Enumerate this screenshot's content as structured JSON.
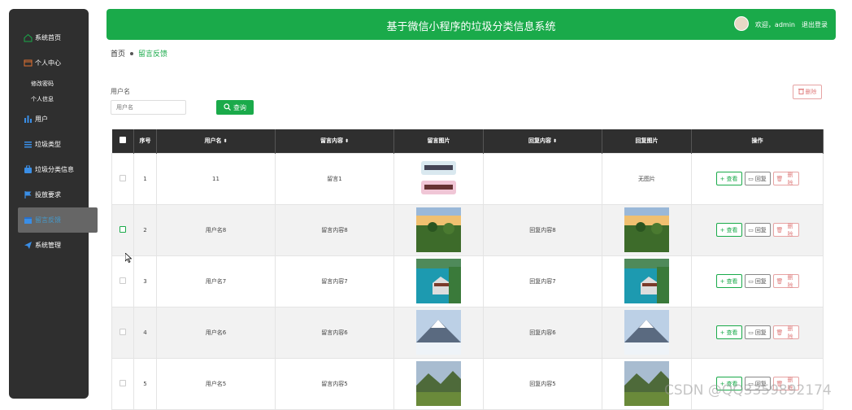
{
  "sidebar": {
    "items": [
      {
        "label": "系统首页",
        "icon": "home-icon"
      },
      {
        "label": "个人中心",
        "icon": "wallet-icon"
      },
      {
        "label": "用户",
        "icon": "bar-chart-icon"
      },
      {
        "label": "垃圾类型",
        "icon": "list-icon"
      },
      {
        "label": "垃圾分类信息",
        "icon": "briefcase-icon"
      },
      {
        "label": "投放要求",
        "icon": "flag-icon"
      },
      {
        "label": "留言反馈",
        "icon": "calendar-icon"
      },
      {
        "label": "系统管理",
        "icon": "send-icon"
      }
    ],
    "sub_items": [
      "修改密码",
      "个人信息"
    ]
  },
  "header": {
    "title": "基于微信小程序的垃圾分类信息系统",
    "welcome": "欢迎，admin",
    "logout": "退出登录"
  },
  "breadcrumb": {
    "home": "首页",
    "current": "留言反馈"
  },
  "search": {
    "label": "用户名",
    "placeholder": "用户名",
    "button": "查询"
  },
  "toolbar": {
    "delete_label": "删除"
  },
  "table": {
    "headers": [
      "序号",
      "用户名",
      "留言内容",
      "留言图片",
      "回复内容",
      "回复图片",
      "操作"
    ],
    "rows": [
      {
        "index": "1",
        "username": "11",
        "content": "留言1",
        "reply": "",
        "reply_image_text": "无图片"
      },
      {
        "index": "2",
        "username": "用户名8",
        "content": "留言内容8",
        "reply": "回复内容8",
        "reply_image_text": ""
      },
      {
        "index": "3",
        "username": "用户名7",
        "content": "留言内容7",
        "reply": "回复内容7",
        "reply_image_text": ""
      },
      {
        "index": "4",
        "username": "用户名6",
        "content": "留言内容6",
        "reply": "回复内容6",
        "reply_image_text": ""
      },
      {
        "index": "5",
        "username": "用户名5",
        "content": "留言内容5",
        "reply": "回复内容5",
        "reply_image_text": ""
      }
    ],
    "actions": {
      "view": "查看",
      "reply": "回复",
      "delete": "删除"
    }
  },
  "watermark": "CSDN @QQ3359892174",
  "colors": {
    "accent": "#1aaa4a",
    "sidebar_bg": "#2f2f2f",
    "danger": "#e08080"
  }
}
